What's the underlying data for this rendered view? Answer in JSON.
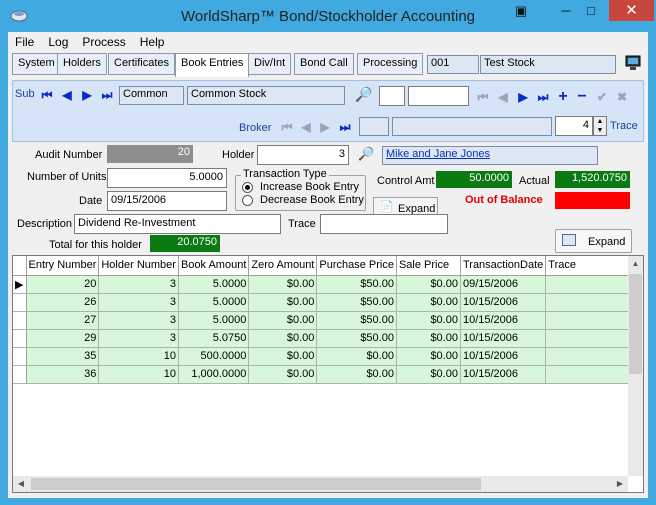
{
  "window": {
    "title": "WorldSharp™ Bond/Stockholder Accounting",
    "close_glyph": "✕",
    "min_glyph": "─",
    "max_glyph": "□",
    "restore_glyph": "▣"
  },
  "menu": [
    "File",
    "Log",
    "Process",
    "Help"
  ],
  "tabs": [
    "System",
    "Holders",
    "Certificates",
    "Book Entries",
    "Div/Int",
    "Bond Call",
    "Processing"
  ],
  "active_tab": "Book Entries",
  "company": {
    "code": "001",
    "name": "Test Stock"
  },
  "sub": {
    "label": "Sub",
    "class_code": "Common",
    "class_name": "Common Stock",
    "search_value_1": "",
    "search_value_2": ""
  },
  "broker": {
    "label": "Broker",
    "value1": "",
    "value2": "",
    "spin_value": "4",
    "trace_label": "Trace"
  },
  "form": {
    "audit_number_label": "Audit Number",
    "audit_number": "20",
    "holder_label": "Holder",
    "holder": "3",
    "holder_name": "Mike and Jane Jones",
    "units_label": "Number of Units",
    "units": "5.0000",
    "date_label": "Date",
    "date": "09/15/2006",
    "transaction_type_label": "Transaction Type",
    "increase_label": "Increase Book Entry",
    "decrease_label": "Decrease Book Entry",
    "control_amt_label": "Control Amt",
    "control_amt": "50.0000",
    "actual_label": "Actual",
    "actual": "1,520.0750",
    "expand_label": "Expand",
    "out_of_balance": "Out of Balance",
    "description_label": "Description",
    "description": "Dividend Re-Investment",
    "trace_label": "Trace",
    "trace": "",
    "total_label": "Total for this holder",
    "total": "20.0750",
    "expand2_label": "Expand"
  },
  "grid": {
    "columns": [
      "Entry Number",
      "Holder Number",
      "Book Amount",
      "Zero Amount",
      "Purchase Price",
      "Sale Price",
      "TransactionDate",
      "Trace"
    ],
    "rows": [
      [
        "20",
        "3",
        "5.0000",
        "$0.00",
        "$50.00",
        "$0.00",
        "09/15/2006",
        ""
      ],
      [
        "26",
        "3",
        "5.0000",
        "$0.00",
        "$50.00",
        "$0.00",
        "10/15/2006",
        ""
      ],
      [
        "27",
        "3",
        "5.0000",
        "$0.00",
        "$50.00",
        "$0.00",
        "10/15/2006",
        ""
      ],
      [
        "29",
        "3",
        "5.0750",
        "$0.00",
        "$50.00",
        "$0.00",
        "10/15/2006",
        ""
      ],
      [
        "35",
        "10",
        "500.0000",
        "$0.00",
        "$0.00",
        "$0.00",
        "10/15/2006",
        ""
      ],
      [
        "36",
        "10",
        "1,000.0000",
        "$0.00",
        "$0.00",
        "$0.00",
        "10/15/2006",
        ""
      ]
    ]
  },
  "colors": {
    "green": "#0b7a12",
    "red": "#ff0000",
    "nav_blue": "#0b29c7"
  }
}
